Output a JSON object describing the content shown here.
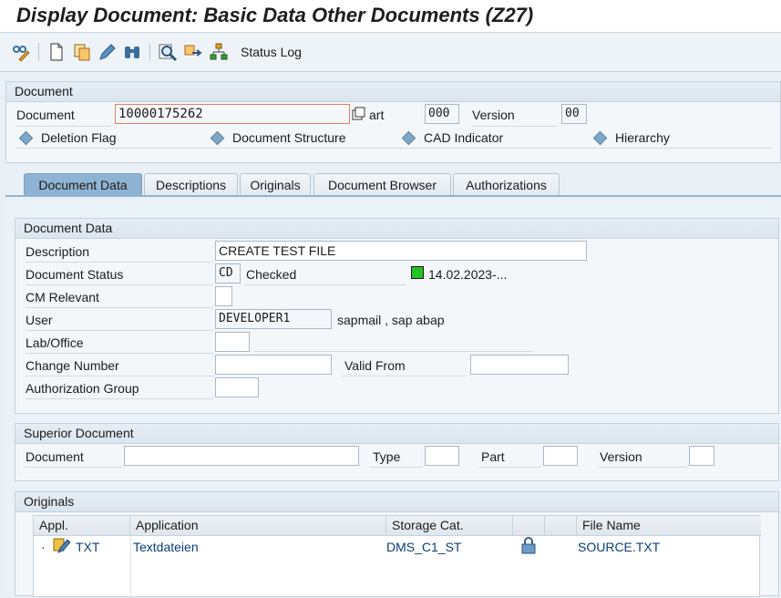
{
  "window": {
    "title": "Display Document: Basic Data Other Documents (Z27)"
  },
  "toolbar": {
    "status_log": "Status Log"
  },
  "document_group": {
    "header": "Document",
    "document_label": "Document",
    "document_value": "10000175262",
    "part_label": "art",
    "part_value": "000",
    "version_label": "Version",
    "version_value": "00",
    "options": [
      "Deletion Flag",
      "Document Structure",
      "CAD Indicator",
      "Hierarchy"
    ]
  },
  "tabs": [
    "Document Data",
    "Descriptions",
    "Originals",
    "Document Browser",
    "Authorizations"
  ],
  "document_data": {
    "header": "Document Data",
    "description_label": "Description",
    "description_value": "CREATE TEST FILE",
    "status_label": "Document Status",
    "status_code": "CD",
    "status_text": "Checked",
    "status_date": "14.02.2023-...",
    "status_color": "#22c322",
    "cm_label": "CM Relevant",
    "user_label": "User",
    "user_value": "DEVELOPER1",
    "user_name": "sapmail , sap abap",
    "lab_label": "Lab/Office",
    "change_label": "Change Number",
    "valid_from_label": "Valid From",
    "auth_group_label": "Authorization Group"
  },
  "superior": {
    "header": "Superior Document",
    "document_label": "Document",
    "type_label": "Type",
    "part_label": "Part",
    "version_label": "Version"
  },
  "originals": {
    "header": "Originals",
    "columns": [
      "Appl.",
      "Application",
      "Storage Cat.",
      "",
      "",
      "File Name"
    ],
    "rows": [
      {
        "appl": "TXT",
        "application": "Textdateien",
        "storage": "DMS_C1_ST",
        "file": "SOURCE.TXT"
      }
    ]
  }
}
